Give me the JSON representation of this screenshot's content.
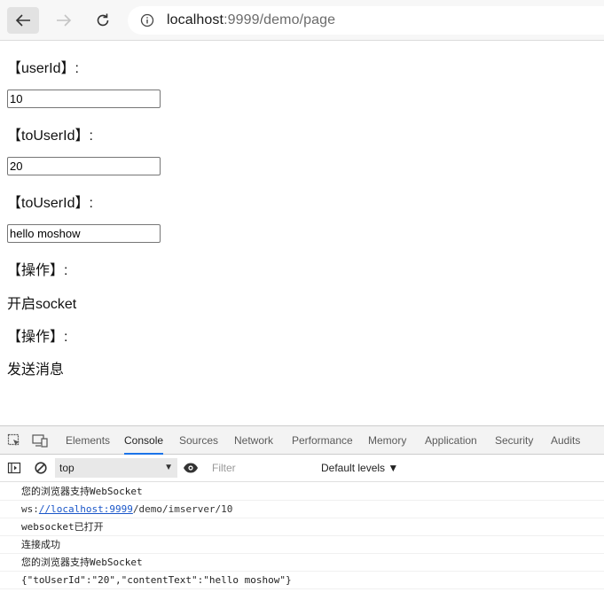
{
  "browser": {
    "url_host": "localhost",
    "url_rest": ":9999/demo/page"
  },
  "page": {
    "userid_label": "【userId】:",
    "userid_value": "10",
    "touserid_label": "【toUserId】:",
    "touserid_value": "20",
    "content_label": "【toUserId】:",
    "content_value": "hello moshow",
    "op_label_1": "【操作】:",
    "open_socket": "开启socket",
    "op_label_2": "【操作】:",
    "send_message": "发送消息"
  },
  "devtools": {
    "tabs": [
      "Elements",
      "Console",
      "Sources",
      "Network",
      "Performance",
      "Memory",
      "Application",
      "Security",
      "Audits"
    ],
    "active_tab": "Console",
    "context": "top",
    "filter_placeholder": "Filter",
    "levels": "Default levels ▼",
    "logs": [
      "您的浏览器支持WebSocket",
      "ws:",
      "//localhost:9999",
      "/demo/imserver/10",
      "websocket已打开",
      "连接成功",
      "您的浏览器支持WebSocket",
      "{\"toUserId\":\"20\",\"contentText\":\"hello moshow\"}"
    ]
  },
  "colors": {
    "accent": "#1a73e8",
    "link": "#1a56c8"
  }
}
